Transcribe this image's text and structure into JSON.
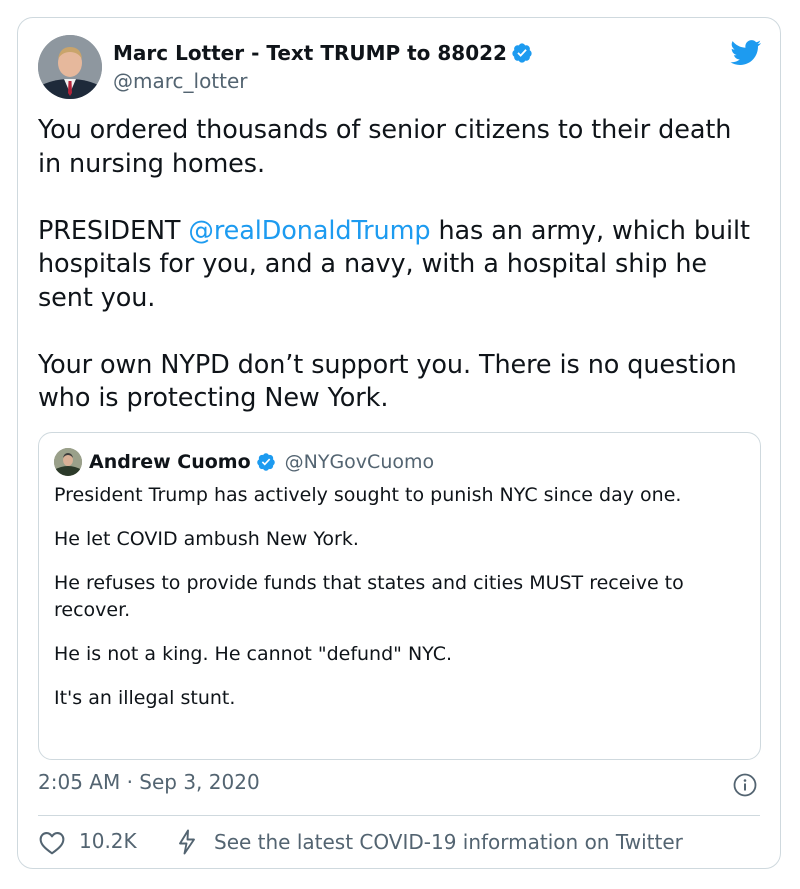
{
  "author": {
    "name": "Marc Lotter - Text TRUMP to 88022",
    "handle": "@marc_lotter",
    "avatar_icon": "person-photo"
  },
  "tweet": {
    "para1": "You ordered thousands of senior citizens to their death in nursing homes.",
    "para2_prefix": "PRESIDENT ",
    "para2_mention": "@realDonaldTrump",
    "para2_suffix": " has an army, which built hospitals for you, and a navy, with a hospital ship he sent you.",
    "para3": "Your own NYPD don’t support you. There is no question who is protecting New York."
  },
  "quoted": {
    "name": "Andrew Cuomo",
    "handle": "@NYGovCuomo",
    "lines": [
      "President Trump has actively sought to punish NYC since day one.",
      "He let COVID ambush New York.",
      "He refuses to provide funds that states and cities MUST receive to recover.",
      "He is not a king. He cannot \"defund\" NYC.",
      "It's an illegal stunt."
    ]
  },
  "meta": {
    "timestamp": "2:05 AM · Sep 3, 2020"
  },
  "actions": {
    "like_count": "10.2K",
    "covid_link": "See the latest COVID-19 information on Twitter"
  },
  "colors": {
    "twitter_blue": "#1d9bf0",
    "text": "#0f1419",
    "muted": "#536471",
    "border": "#cfd9de"
  }
}
